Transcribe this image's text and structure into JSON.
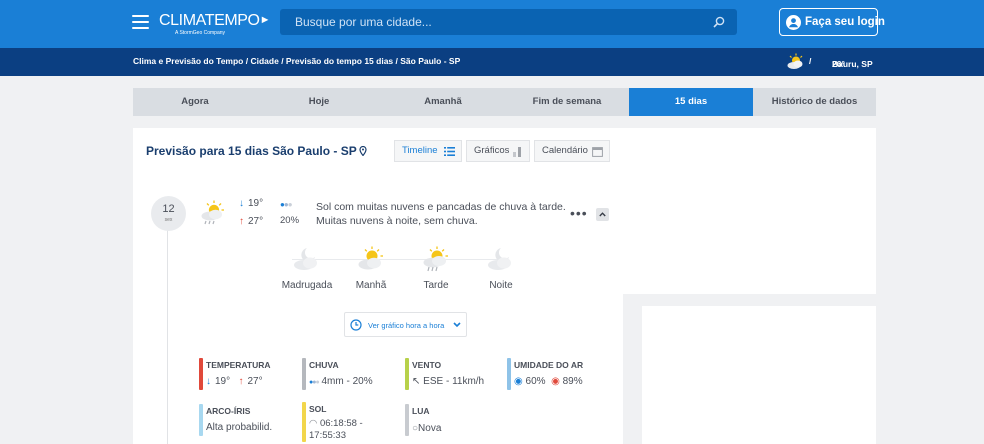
{
  "header": {
    "logo": {
      "brand": "CLIMATEMPO",
      "tagline": "A StormGeo Company"
    },
    "search_placeholder": "Busque por uma cidade...",
    "login_label": "Faça seu login"
  },
  "breadcrumb": {
    "items": [
      "Clima e Previsão do Tempo",
      "Cidade",
      "Previsão do tempo 15 dias",
      "São Paulo - SP"
    ],
    "separator": " / "
  },
  "current_city": {
    "label": "Bauru, SP",
    "temp": "26°"
  },
  "tabs": [
    {
      "label": "Agora"
    },
    {
      "label": "Hoje"
    },
    {
      "label": "Amanhã"
    },
    {
      "label": "Fim de semana"
    },
    {
      "label": "15 dias",
      "active": true
    },
    {
      "label": "Histórico de dados"
    }
  ],
  "forecast": {
    "title": "Previsão para 15 dias São Paulo - SP",
    "view_buttons": [
      {
        "label": "Timeline",
        "icon": "list-icon",
        "selected": true
      },
      {
        "label": "Gráficos",
        "icon": "bar-chart-icon"
      },
      {
        "label": "Calendário",
        "icon": "calendar-icon"
      }
    ],
    "day": {
      "number": "12",
      "weekday": "sex",
      "min_temp": "19°",
      "max_temp": "27°",
      "rain_pct": "20%",
      "description": "Sol com muitas nuvens e pancadas de chuva à tarde. Muitas nuvens à noite, sem chuva.",
      "periods": [
        {
          "label": "Madrugada",
          "icon": "moon-cloud-icon"
        },
        {
          "label": "Manhã",
          "icon": "sun-cloud-icon"
        },
        {
          "label": "Tarde",
          "icon": "sun-cloud-rain-icon"
        },
        {
          "label": "Noite",
          "icon": "moon-cloud-icon"
        }
      ],
      "hour_chart_label": "Ver gráfico hora a hora",
      "details": {
        "temperature": {
          "title": "TEMPERATURA",
          "min": "19°",
          "max": "27°",
          "color": "#e0493b"
        },
        "rain": {
          "title": "CHUVA",
          "value": "4mm - 20%",
          "color": "#b5b8bd"
        },
        "wind": {
          "title": "VENTO",
          "value": "ESE - 11km/h",
          "color": "#b7d14a"
        },
        "humidity": {
          "title": "UMIDADE DO AR",
          "min": "60%",
          "max": "89%",
          "color": "#8fc3e8"
        },
        "rainbow": {
          "title": "ARCO-ÍRIS",
          "value": "Alta probabilid.",
          "color": "#a8d8f0"
        },
        "sun": {
          "title": "SOL",
          "value": "06:18:58 - 17:55:33",
          "color": "#f2d64b"
        },
        "moon": {
          "title": "LUA",
          "value": "Nova",
          "color": "#c8cbd0"
        }
      }
    }
  }
}
